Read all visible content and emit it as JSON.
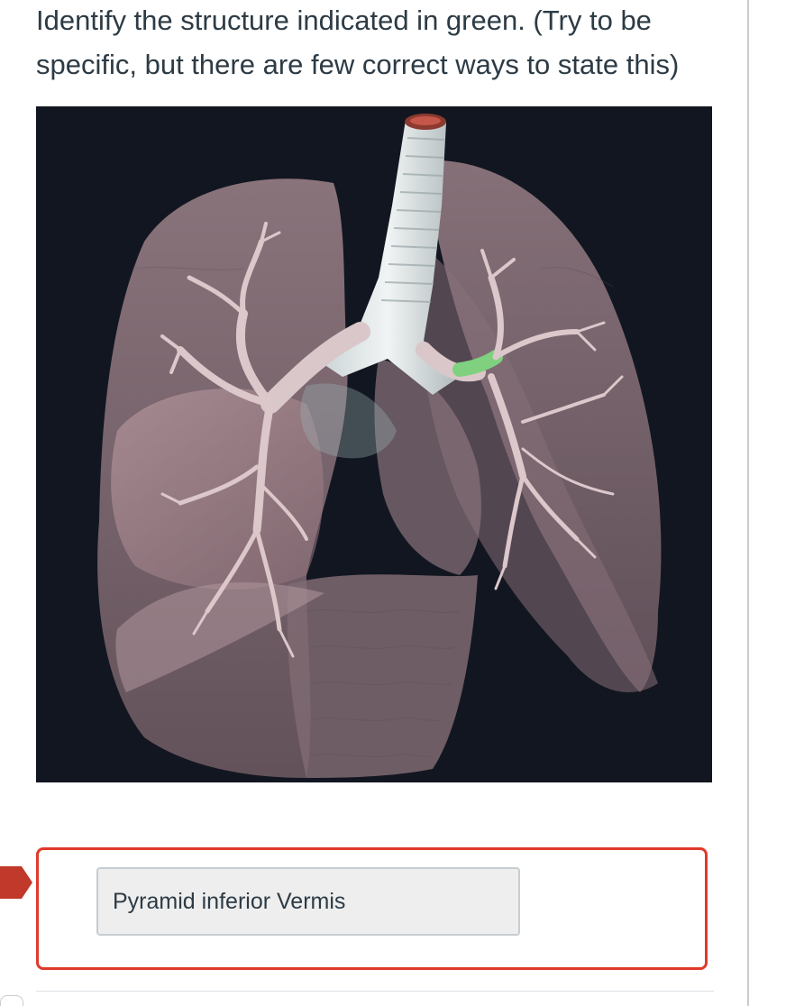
{
  "question": {
    "text": "Identify the structure indicated in green. (Try to be specific, but there are few correct ways to state this)"
  },
  "figure": {
    "subject": "lungs with bronchial tree",
    "highlight_color": "#7fd17f",
    "background_color": "#121620",
    "lung_color": "#a88c94"
  },
  "answer": {
    "value": "Pyramid inferior Vermis",
    "status": "incorrect",
    "status_color": "#e0392b"
  },
  "icons": {
    "marker": "incorrect-arrow-icon"
  }
}
